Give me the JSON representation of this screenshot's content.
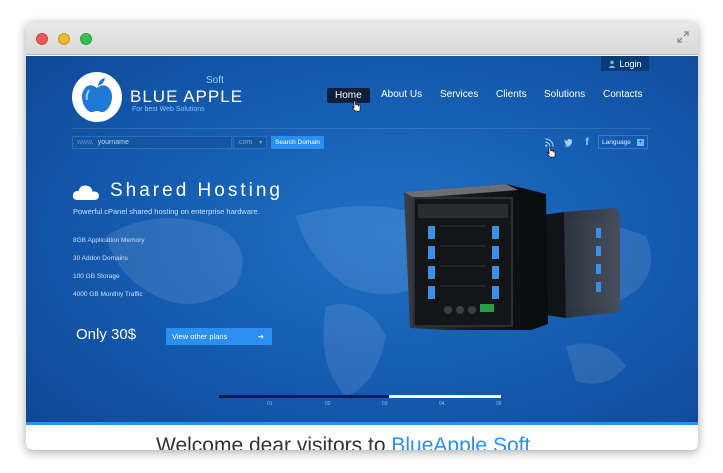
{
  "site": {
    "login_label": "Login",
    "logo": {
      "name": "Blue Apple",
      "soft": "Soft",
      "tagline": "For best Web Solutions"
    },
    "nav": [
      "Home",
      "About Us",
      "Services",
      "Clients",
      "Solutions",
      "Contacts"
    ],
    "domain_search": {
      "prefix": "www.",
      "value": "yourname",
      "extension": ".com",
      "button": "Search Domain"
    },
    "language_label": "Language",
    "hero": {
      "title": "Shared Hosting",
      "subtitle": "Powerful cPanel shared hosting on enterprise hardware.",
      "features": [
        "8GB Application Memory",
        "30 Addon Domains",
        "100 GB Storage",
        "4000 GB Monthly Traffic"
      ],
      "price": "Only 30$",
      "plans_button": "View other plans"
    },
    "slider_labels": [
      "01",
      "02",
      "03",
      "04",
      "05"
    ],
    "slider_progress": 0.6,
    "welcome_text": "Welcome dear visitors to",
    "welcome_brand": "BlueApple Soft"
  },
  "colors": {
    "background": "#1459ad",
    "accent": "#2a8ff0",
    "nav_active": "#0d1f3a"
  },
  "icons": [
    "close-dot",
    "minimize-dot",
    "zoom-dot",
    "resize-icon",
    "user-icon",
    "apple-logo",
    "cursor-icon",
    "rss-icon",
    "twitter-icon",
    "facebook-icon",
    "plus-icon",
    "cloud-icon",
    "arrow-right-icon",
    "server-image"
  ]
}
